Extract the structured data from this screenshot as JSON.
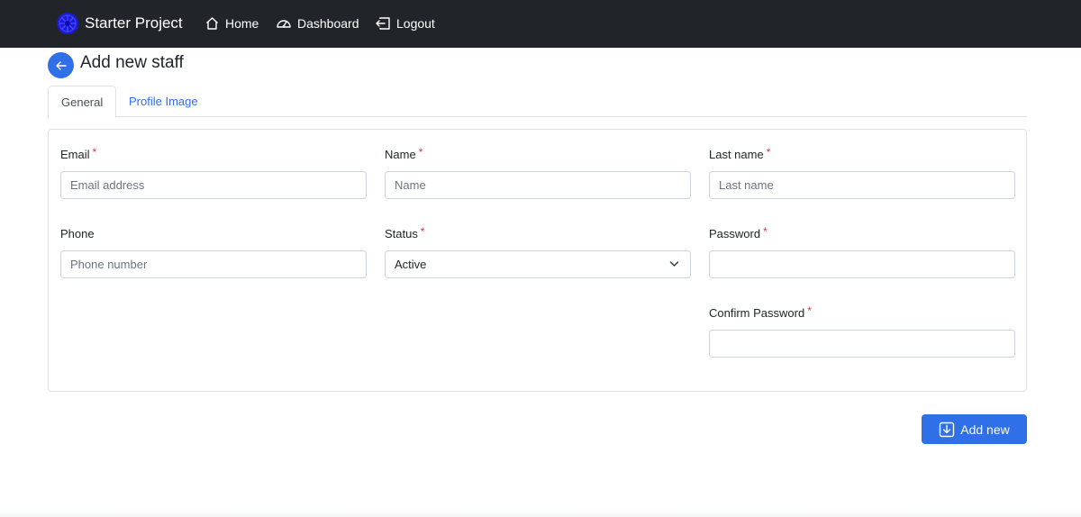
{
  "navbar": {
    "brand": "Starter Project",
    "items": [
      {
        "label": "Home",
        "icon": "home-icon"
      },
      {
        "label": "Dashboard",
        "icon": "speedometer-icon"
      },
      {
        "label": "Logout",
        "icon": "logout-icon"
      }
    ],
    "background": "#212529"
  },
  "page": {
    "title": "Add new staff",
    "back_icon": "arrow-left-icon"
  },
  "tabs": [
    {
      "label": "General",
      "active": true
    },
    {
      "label": "Profile Image",
      "active": false
    }
  ],
  "form": {
    "email": {
      "label": "Email",
      "required": "*",
      "placeholder": "Email address",
      "value": ""
    },
    "name": {
      "label": "Name",
      "required": "*",
      "placeholder": "Name",
      "value": ""
    },
    "last_name": {
      "label": "Last name",
      "required": "*",
      "placeholder": "Last name",
      "value": ""
    },
    "phone": {
      "label": "Phone",
      "placeholder": "Phone number",
      "value": ""
    },
    "status": {
      "label": "Status",
      "required": "*",
      "selected": "Active"
    },
    "password": {
      "label": "Password",
      "required": "*",
      "value": ""
    },
    "confirm_password": {
      "label": "Confirm Password",
      "required": "*",
      "value": ""
    }
  },
  "actions": {
    "add_label": "Add new",
    "add_icon": "save-download-icon"
  },
  "colors": {
    "primary": "#2f6fe8",
    "required": "#dc3545",
    "brand_logo": "#1a1ad6"
  }
}
